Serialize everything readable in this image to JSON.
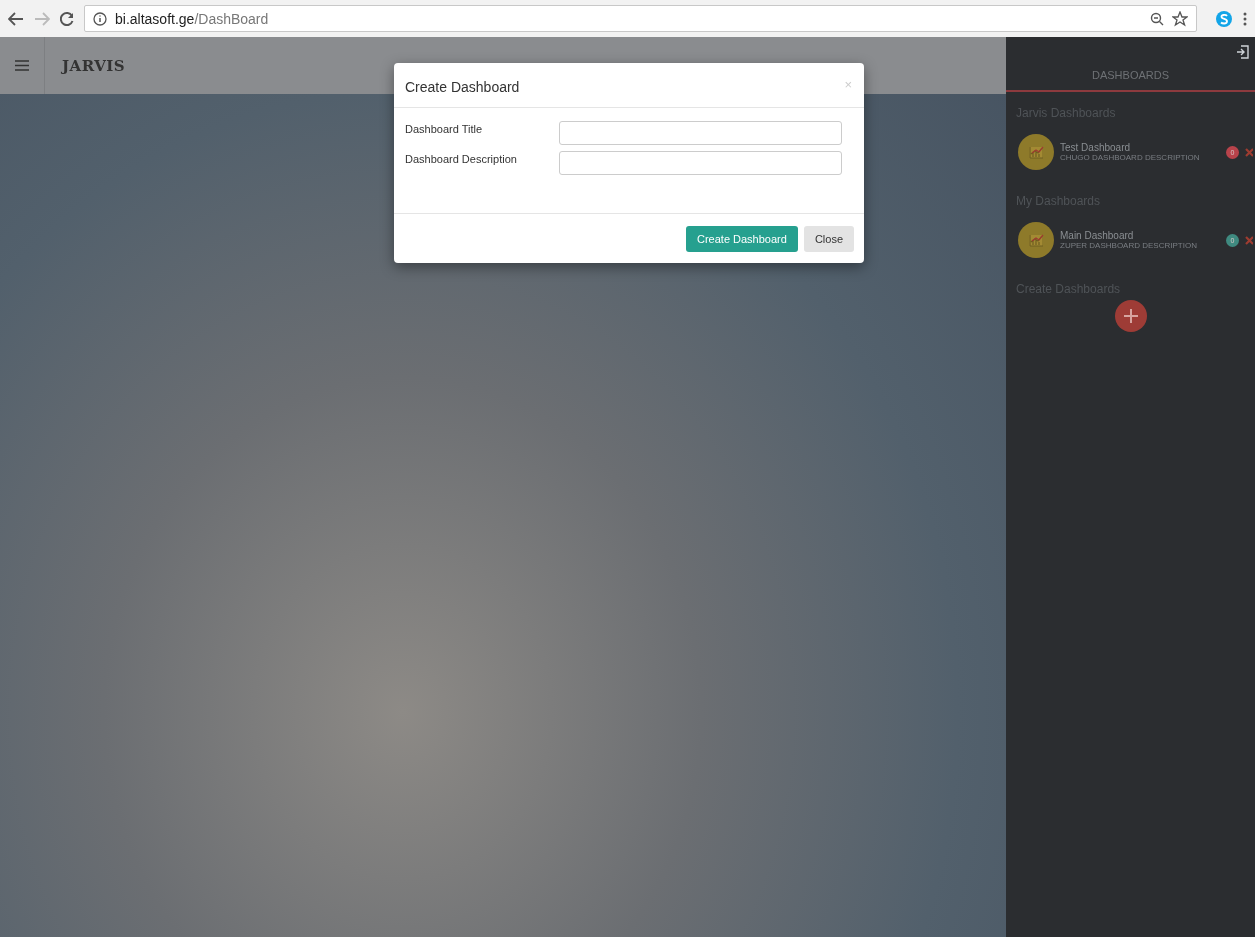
{
  "browser": {
    "url_host": "bi.altasoft.ge",
    "url_path": "/DashBoard"
  },
  "header": {
    "title": "JARVIS"
  },
  "modal": {
    "title": "Create Dashboard",
    "close_symbol": "×",
    "fields": [
      {
        "label": "Dashboard Title"
      },
      {
        "label": "Dashboard Description"
      }
    ],
    "buttons": [
      {
        "label": "Create Dashboard",
        "kind": "primary"
      },
      {
        "label": "Close",
        "kind": "default"
      }
    ]
  },
  "sidebar": {
    "heading": "DASHBOARDS",
    "groups": [
      {
        "title": "Jarvis Dashboards",
        "items": [
          {
            "name": "Test Dashboard",
            "description": "CHUGO DASHBOARD DESCRIPTION",
            "count": "0",
            "color": "#b8434b"
          }
        ]
      },
      {
        "title": "My Dashboards",
        "items": [
          {
            "name": "Main Dashboard",
            "description": "ZUPER DASHBOARD DESCRIPTION",
            "count": "0",
            "color": "#3f8a80"
          }
        ]
      }
    ],
    "create_label": "Create Dashboards"
  }
}
